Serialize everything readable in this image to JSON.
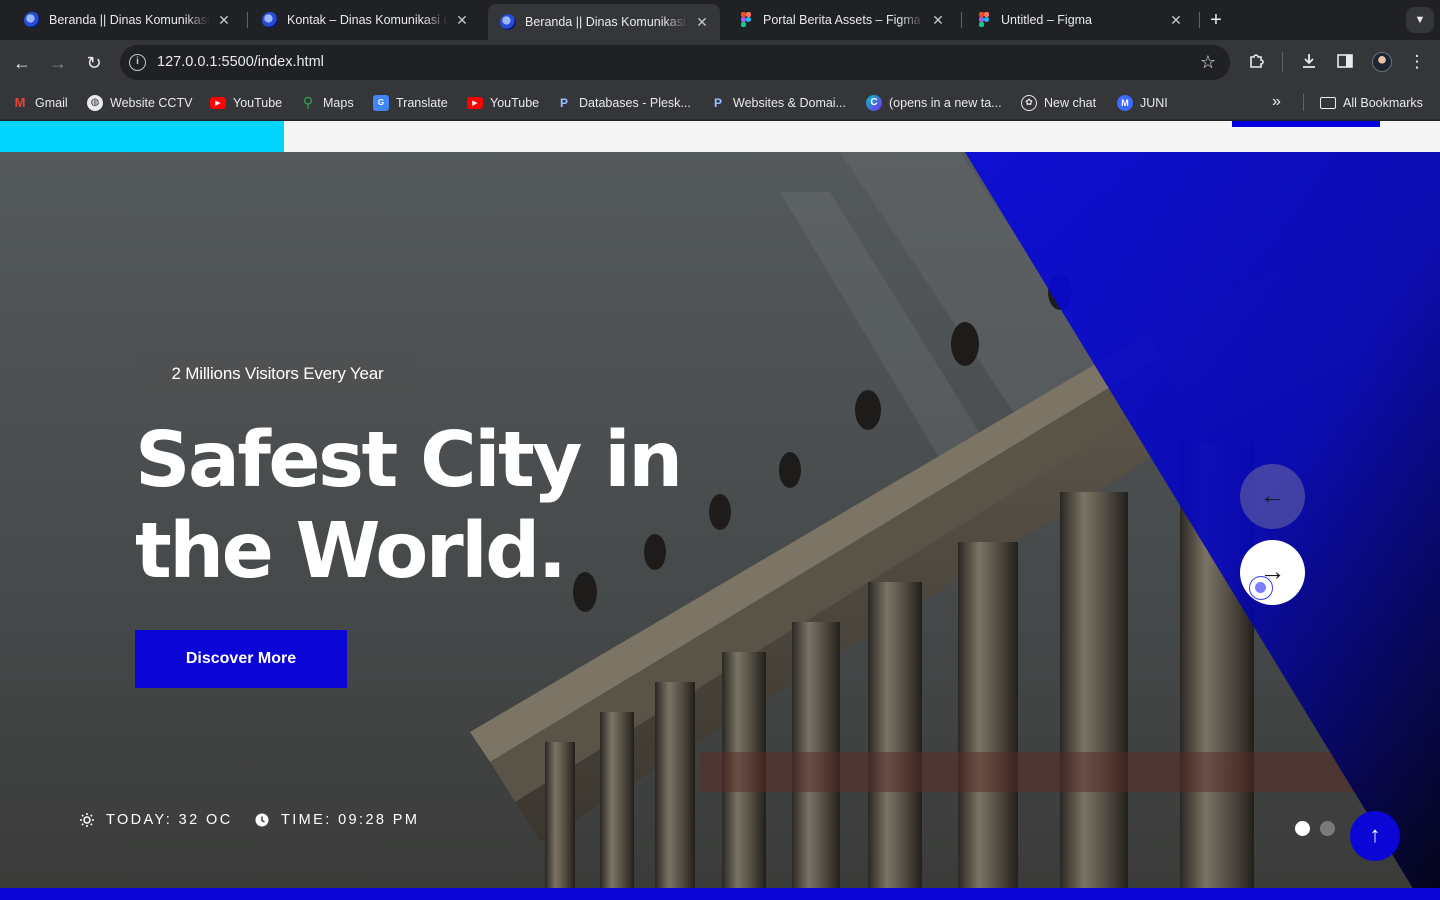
{
  "browser": {
    "tabs": [
      {
        "title": "Beranda || Dinas Komunikasi dan",
        "favicon": "diskom-logo-icon",
        "active": false
      },
      {
        "title": "Kontak – Dinas Komunikasi dan",
        "favicon": "diskom-logo-icon",
        "active": false
      },
      {
        "title": "Beranda || Dinas Komunikasi dan",
        "favicon": "diskom-logo-icon",
        "active": true
      },
      {
        "title": "Portal Berita Assets – Figma",
        "favicon": "figma-icon",
        "active": false
      },
      {
        "title": "Untitled – Figma",
        "favicon": "figma-icon",
        "active": false
      }
    ],
    "url": "127.0.0.1:5500/index.html",
    "bookmarks": [
      {
        "label": "Gmail",
        "icon": "gmail-icon"
      },
      {
        "label": "Website CCTV",
        "icon": "globe-icon"
      },
      {
        "label": "YouTube",
        "icon": "youtube-icon"
      },
      {
        "label": "Maps",
        "icon": "maps-icon"
      },
      {
        "label": "Translate",
        "icon": "translate-icon"
      },
      {
        "label": "YouTube",
        "icon": "youtube-icon"
      },
      {
        "label": "Databases - Plesk...",
        "icon": "plesk-icon"
      },
      {
        "label": "Websites & Domai...",
        "icon": "plesk-icon"
      },
      {
        "label": "(opens in a new ta...",
        "icon": "canva-icon"
      },
      {
        "label": "New chat",
        "icon": "chatgpt-icon"
      },
      {
        "label": "JUNI",
        "icon": "juni-icon"
      }
    ],
    "all_bookmarks_label": "All Bookmarks"
  },
  "hero": {
    "badge": "2 Millions Visitors Every Year",
    "headline_line1": "Safest City in",
    "headline_line2": "the World.",
    "cta_label": "Discover More",
    "weather": "TODAY: 32 OC",
    "time": "TIME: 09:28 PM",
    "slide_count": 2,
    "active_slide": 1,
    "prev_arrow": "←",
    "next_arrow": "→",
    "to_top_arrow": "↑"
  },
  "colors": {
    "brand_blue": "#0b05d6",
    "accent_cyan": "#00d4ff",
    "chrome_dark": "#202124",
    "chrome_toolbar": "#35363a"
  }
}
